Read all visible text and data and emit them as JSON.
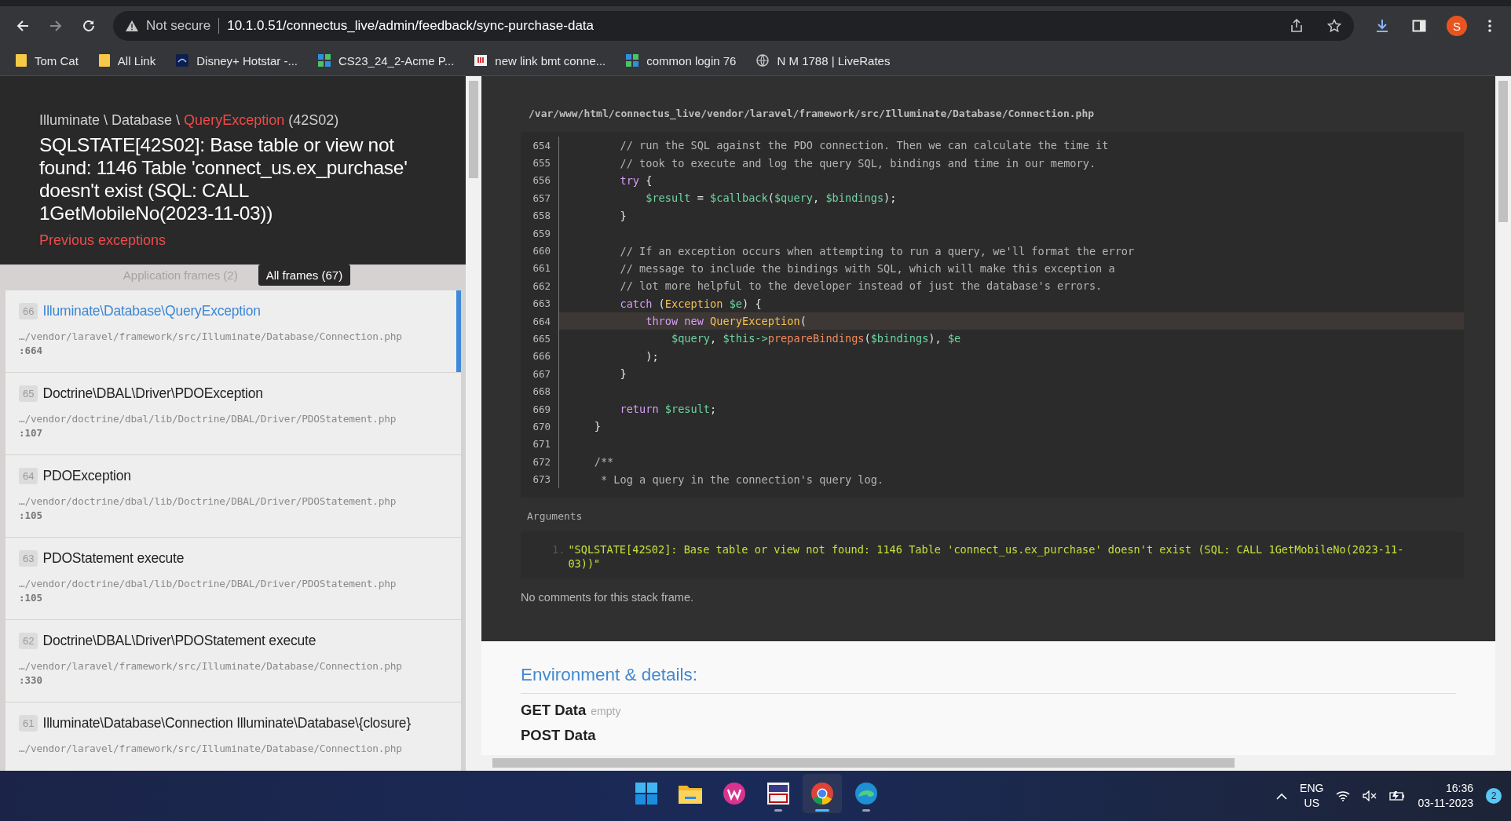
{
  "browser": {
    "nav": [
      {
        "kind": "back",
        "disabled": false
      },
      {
        "kind": "forward",
        "disabled": true
      },
      {
        "kind": "reload",
        "disabled": false
      }
    ],
    "security": "Not secure",
    "url": "10.1.0.51/connectus_live/admin/feedback/sync-purchase-data",
    "avatar": "S",
    "bookmarks": [
      {
        "label": "Tom Cat",
        "kind": "folder"
      },
      {
        "label": "All Link",
        "kind": "folder"
      },
      {
        "label": "Disney+ Hotstar -...",
        "kind": "tile"
      },
      {
        "label": "CS23_24_2-Acme P...",
        "kind": "grid"
      },
      {
        "label": "new link bmt conne...",
        "kind": "flag"
      },
      {
        "label": "common login 76",
        "kind": "grid"
      },
      {
        "label": "N M 1788 | LiveRates",
        "kind": "globe"
      }
    ]
  },
  "error": {
    "namespace": "Illuminate \\ Database \\",
    "exception": "QueryException",
    "code": "(42S02)",
    "message": "SQLSTATE[42S02]: Base table or view not found: 1146 Table 'connect_us.ex_purchase' doesn't exist (SQL: CALL 1GetMobileNo(2023-11-03))",
    "previous": "Previous exceptions"
  },
  "frame_tabs": [
    {
      "label": "Application frames (2)",
      "selected": false
    },
    {
      "label": "All frames (67)",
      "selected": true
    }
  ],
  "frames": [
    {
      "number": "66",
      "class": "Illuminate\\Database\\QueryException",
      "file": "…/vendor/laravel/framework/src/Illuminate/Database/Connection.php",
      "line": ":664",
      "selected": true
    },
    {
      "number": "65",
      "class": "Doctrine\\DBAL\\Driver\\PDOException",
      "file": "…/vendor/doctrine/dbal/lib/Doctrine/DBAL/Driver/PDOStatement.php",
      "line": ":107",
      "selected": false
    },
    {
      "number": "64",
      "class": "PDOException",
      "file": "…/vendor/doctrine/dbal/lib/Doctrine/DBAL/Driver/PDOStatement.php",
      "line": ":105",
      "selected": false
    },
    {
      "number": "63",
      "class": "PDOStatement execute",
      "file": "…/vendor/doctrine/dbal/lib/Doctrine/DBAL/Driver/PDOStatement.php",
      "line": ":105",
      "selected": false
    },
    {
      "number": "62",
      "class": "Doctrine\\DBAL\\Driver\\PDOStatement execute",
      "file": "…/vendor/laravel/framework/src/Illuminate/Database/Connection.php",
      "line": ":330",
      "selected": false
    },
    {
      "number": "61",
      "class": "Illuminate\\Database\\Connection Illuminate\\Database\\{closure}",
      "file": "…/vendor/laravel/framework/src/Illuminate/Database/Connection.php",
      "selected": false
    }
  ],
  "code": {
    "file": "/var/www/html/connectus_live/vendor/laravel/framework/src/Illuminate/Database/Connection.php",
    "lines": [
      {
        "number": "654",
        "highlighted": false,
        "segments": [
          {
            "kind": "comment",
            "text": "        // run the SQL against the PDO connection. Then we can calculate the time it"
          }
        ]
      },
      {
        "number": "655",
        "highlighted": false,
        "segments": [
          {
            "kind": "comment",
            "text": "        // took to execute and log the query SQL, bindings and time in our memory."
          }
        ]
      },
      {
        "number": "656",
        "highlighted": false,
        "segments": [
          {
            "kind": "keyword",
            "text": "        try"
          },
          {
            "kind": "plain",
            "text": " {"
          }
        ]
      },
      {
        "number": "657",
        "highlighted": false,
        "segments": [
          {
            "kind": "variable",
            "text": "            $result"
          },
          {
            "kind": "plain",
            "text": " = "
          },
          {
            "kind": "variable",
            "text": "$callback"
          },
          {
            "kind": "plain",
            "text": "("
          },
          {
            "kind": "variable",
            "text": "$query"
          },
          {
            "kind": "plain",
            "text": ", "
          },
          {
            "kind": "variable",
            "text": "$bindings"
          },
          {
            "kind": "plain",
            "text": ");"
          }
        ]
      },
      {
        "number": "658",
        "highlighted": false,
        "segments": [
          {
            "kind": "plain",
            "text": "        }"
          }
        ]
      },
      {
        "number": "659",
        "highlighted": false
      },
      {
        "number": "660",
        "highlighted": false,
        "segments": [
          {
            "kind": "comment",
            "text": "        // If an exception occurs when attempting to run a query, we'll format the error"
          }
        ]
      },
      {
        "number": "661",
        "highlighted": false,
        "segments": [
          {
            "kind": "comment",
            "text": "        // message to include the bindings with SQL, which will make this exception a"
          }
        ]
      },
      {
        "number": "662",
        "highlighted": false,
        "segments": [
          {
            "kind": "comment",
            "text": "        // lot more helpful to the developer instead of just the database's errors."
          }
        ]
      },
      {
        "number": "663",
        "highlighted": false,
        "segments": [
          {
            "kind": "keyword",
            "text": "        catch"
          },
          {
            "kind": "plain",
            "text": " ("
          },
          {
            "kind": "class",
            "text": "Exception"
          },
          {
            "kind": "variable",
            "text": " $e"
          },
          {
            "kind": "plain",
            "text": ") {"
          }
        ]
      },
      {
        "number": "664",
        "highlighted": true,
        "segments": [
          {
            "kind": "keyword",
            "text": "            throw new"
          },
          {
            "kind": "class",
            "text": " QueryException"
          },
          {
            "kind": "plain",
            "text": "("
          }
        ]
      },
      {
        "number": "665",
        "highlighted": false,
        "segments": [
          {
            "kind": "variable",
            "text": "                $query"
          },
          {
            "kind": "plain",
            "text": ", "
          },
          {
            "kind": "variable",
            "text": "$this->"
          },
          {
            "kind": "function",
            "text": "prepareBindings"
          },
          {
            "kind": "plain",
            "text": "("
          },
          {
            "kind": "variable",
            "text": "$bindings"
          },
          {
            "kind": "plain",
            "text": "), "
          },
          {
            "kind": "variable",
            "text": "$e"
          }
        ]
      },
      {
        "number": "666",
        "highlighted": false,
        "segments": [
          {
            "kind": "plain",
            "text": "            );"
          }
        ]
      },
      {
        "number": "667",
        "highlighted": false,
        "segments": [
          {
            "kind": "plain",
            "text": "        }"
          }
        ]
      },
      {
        "number": "668",
        "highlighted": false
      },
      {
        "number": "669",
        "highlighted": false,
        "segments": [
          {
            "kind": "keyword",
            "text": "        return"
          },
          {
            "kind": "variable",
            "text": " $result"
          },
          {
            "kind": "plain",
            "text": ";"
          }
        ]
      },
      {
        "number": "670",
        "highlighted": false,
        "segments": [
          {
            "kind": "plain",
            "text": "    }"
          }
        ]
      },
      {
        "number": "671",
        "highlighted": false
      },
      {
        "number": "672",
        "highlighted": false,
        "segments": [
          {
            "kind": "comment",
            "text": "    /**"
          }
        ]
      },
      {
        "number": "673",
        "highlighted": false,
        "segments": [
          {
            "kind": "comment",
            "text": "     * Log a query in the connection's query log."
          }
        ]
      }
    ]
  },
  "arguments": {
    "label": "Arguments",
    "items": [
      {
        "number": "1.",
        "value": "\"SQLSTATE[42S02]: Base table or view not found: 1146 Table 'connect_us.ex_purchase' doesn't exist (SQL: CALL 1GetMobileNo(2023-11-03))\""
      }
    ]
  },
  "comments": "No comments for this stack frame.",
  "environment": {
    "title": "Environment & details:",
    "sections": [
      {
        "title": "GET Data",
        "note": "empty"
      },
      {
        "title": "POST Data"
      }
    ]
  },
  "taskbar": {
    "apps": [
      {
        "kind": "start",
        "running": false,
        "selected": false
      },
      {
        "kind": "folder",
        "running": false,
        "selected": false
      },
      {
        "kind": "wps",
        "running": false,
        "selected": false
      },
      {
        "kind": "vnc",
        "running": true,
        "selected": false
      },
      {
        "kind": "chrome",
        "running": true,
        "selected": true
      },
      {
        "kind": "edge",
        "running": true,
        "selected": false
      }
    ],
    "language": "ENG",
    "region": "US",
    "time": "16:36",
    "date": "03-11-2023",
    "notifications": "2"
  }
}
